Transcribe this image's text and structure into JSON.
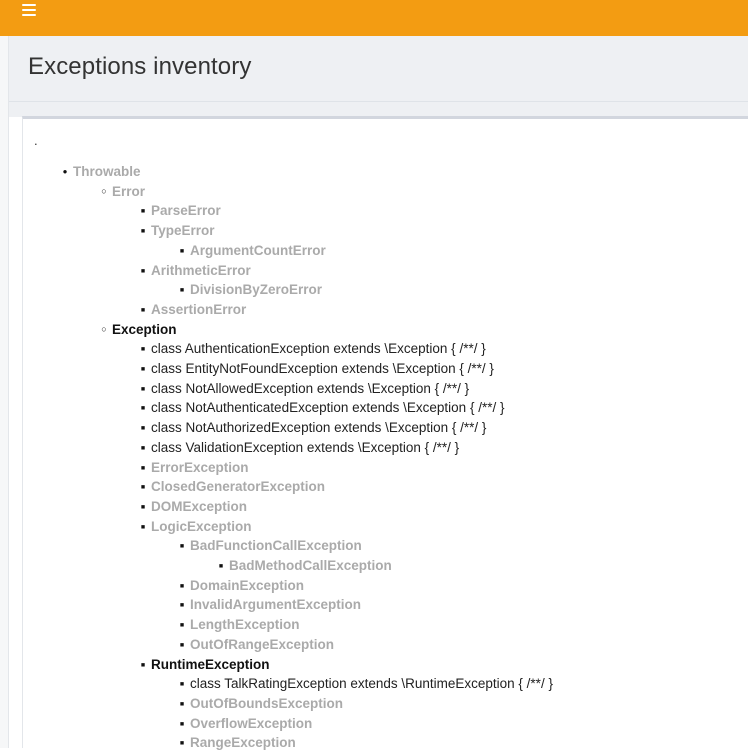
{
  "title": "Exceptions inventory",
  "dot": ".",
  "tree": [
    {
      "label": "Throwable",
      "level": 0,
      "style": "muted"
    },
    {
      "label": "Error",
      "level": 1,
      "style": "muted"
    },
    {
      "label": "ParseError",
      "level": 2,
      "style": "muted"
    },
    {
      "label": "TypeError",
      "level": 2,
      "style": "muted"
    },
    {
      "label": "ArgumentCountError",
      "level": 3,
      "style": "muted"
    },
    {
      "label": "ArithmeticError",
      "level": 2,
      "style": "muted"
    },
    {
      "label": "DivisionByZeroError",
      "level": 3,
      "style": "muted"
    },
    {
      "label": "AssertionError",
      "level": 2,
      "style": "muted"
    },
    {
      "label": "Exception",
      "level": 1,
      "style": "strong"
    },
    {
      "label": "class AuthenticationException extends \\Exception { /**/ }",
      "level": 2,
      "style": "code"
    },
    {
      "label": "class EntityNotFoundException extends \\Exception { /**/ }",
      "level": 2,
      "style": "code"
    },
    {
      "label": "class NotAllowedException extends \\Exception { /**/ }",
      "level": 2,
      "style": "code"
    },
    {
      "label": "class NotAuthenticatedException extends \\Exception { /**/ }",
      "level": 2,
      "style": "code"
    },
    {
      "label": "class NotAuthorizedException extends \\Exception { /**/ }",
      "level": 2,
      "style": "code"
    },
    {
      "label": "class ValidationException extends \\Exception { /**/ }",
      "level": 2,
      "style": "code"
    },
    {
      "label": "ErrorException",
      "level": 2,
      "style": "muted"
    },
    {
      "label": "ClosedGeneratorException",
      "level": 2,
      "style": "muted"
    },
    {
      "label": "DOMException",
      "level": 2,
      "style": "muted"
    },
    {
      "label": "LogicException",
      "level": 2,
      "style": "muted"
    },
    {
      "label": "BadFunctionCallException",
      "level": 3,
      "style": "muted"
    },
    {
      "label": "BadMethodCallException",
      "level": 4,
      "style": "muted"
    },
    {
      "label": "DomainException",
      "level": 3,
      "style": "muted"
    },
    {
      "label": "InvalidArgumentException",
      "level": 3,
      "style": "muted"
    },
    {
      "label": "LengthException",
      "level": 3,
      "style": "muted"
    },
    {
      "label": "OutOfRangeException",
      "level": 3,
      "style": "muted"
    },
    {
      "label": "RuntimeException",
      "level": 2,
      "style": "strong"
    },
    {
      "label": "class TalkRatingException extends \\RuntimeException { /**/ }",
      "level": 3,
      "style": "code"
    },
    {
      "label": "OutOfBoundsException",
      "level": 3,
      "style": "muted"
    },
    {
      "label": "OverflowException",
      "level": 3,
      "style": "muted"
    },
    {
      "label": "RangeException",
      "level": 3,
      "style": "muted"
    }
  ]
}
